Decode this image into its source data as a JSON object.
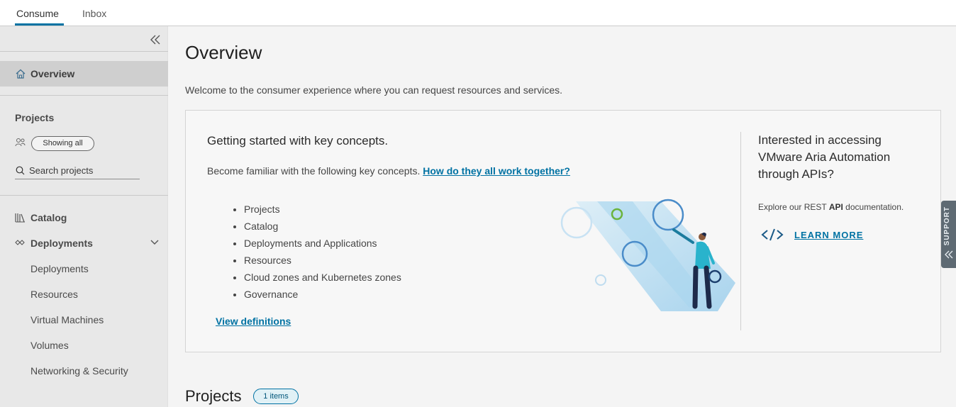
{
  "top_tabs": [
    {
      "label": "Consume",
      "active": true
    },
    {
      "label": "Inbox",
      "active": false
    }
  ],
  "sidebar": {
    "overview_label": "Overview",
    "projects_heading": "Projects",
    "showing_all_label": "Showing all",
    "search_placeholder": "Search projects",
    "items": [
      {
        "label": "Catalog",
        "icon": "catalog-icon"
      },
      {
        "label": "Deployments",
        "icon": "deployments-icon",
        "expanded": true
      },
      {
        "label": "Deployments"
      },
      {
        "label": "Resources"
      },
      {
        "label": "Virtual Machines"
      },
      {
        "label": "Volumes"
      },
      {
        "label": "Networking & Security"
      }
    ]
  },
  "main": {
    "title": "Overview",
    "welcome_text": "Welcome to the consumer experience where you can request resources and services.",
    "card": {
      "title": "Getting started with key concepts.",
      "intro_text": "Become familiar with the following key concepts. ",
      "intro_link": "How do they all work together?",
      "concepts": [
        "Projects",
        "Catalog",
        "Deployments and Applications",
        "Resources",
        "Cloud zones and Kubernetes zones",
        "Governance"
      ],
      "view_definitions": "View definitions",
      "api_title": "Interested in accessing VMware Aria Automation through APIs?",
      "api_desc_prefix": "Explore our REST ",
      "api_desc_bold": "API",
      "api_desc_suffix": " documentation.",
      "learn_more": "LEARN MORE"
    },
    "projects_title": "Projects",
    "projects_count": "1 items"
  },
  "support_label": "SUPPORT",
  "colors": {
    "accent": "#0072a3",
    "sidebar_bg": "#e8e8e8",
    "active_nav_bg": "#cfcfcf",
    "support_bg": "#5e6a73"
  }
}
